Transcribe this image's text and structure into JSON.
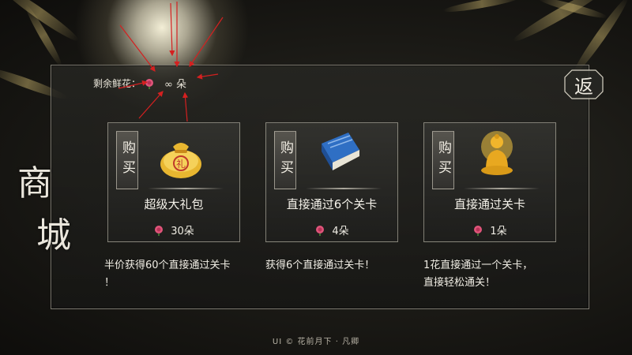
{
  "header": {
    "flowers_label": "剩余鲜花：",
    "flowers_value": "∞ 朵",
    "back_button": "返"
  },
  "side_title": {
    "char1": "商",
    "char2": "城"
  },
  "cards": [
    {
      "tag": "购买",
      "icon": "money-bag-icon",
      "title": "超级大礼包",
      "price": "30朵",
      "description_line1": "半价获得60个直接通过关卡",
      "description_line2": "！"
    },
    {
      "tag": "购买",
      "icon": "blue-book-icon",
      "title": "直接通过6个关卡",
      "price": "4朵",
      "description_line1": "获得6个直接通过关卡！",
      "description_line2": ""
    },
    {
      "tag": "购买",
      "icon": "golden-buddha-icon",
      "title": "直接通过关卡",
      "price": "1朵",
      "description_line1": "1花直接通过一个关卡，",
      "description_line2": "直接轻松通关！"
    }
  ],
  "footer": {
    "text": "UI © 花前月下 · 凡卿"
  },
  "colors": {
    "accent_gold": "#e8b630",
    "rose": "#e0557a",
    "annotation_arrow": "#d42020",
    "panel_border": "#cfcabc"
  }
}
